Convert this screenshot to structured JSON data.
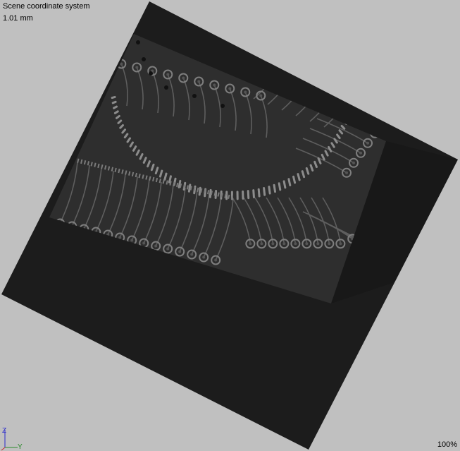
{
  "view": {
    "title": "Scene coordinate system",
    "scale_label": "1.01 mm",
    "zoom": "100%"
  },
  "axes": {
    "z_label": "Z",
    "y_label": "Y",
    "z_color": "#2a2acc",
    "y_color": "#2a8a2a",
    "x_color": "#cc2a2a"
  },
  "colors": {
    "background": "#c0c0c0",
    "slab": "#1c1c1c",
    "board": "#2e2e2e",
    "trace": "#6a6a6a",
    "pad": "#8a8a8a"
  }
}
